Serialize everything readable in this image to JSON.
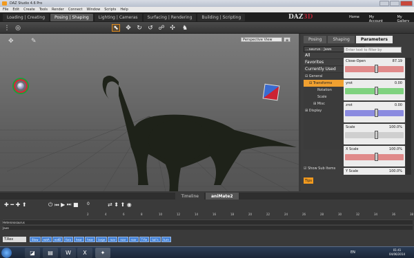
{
  "window": {
    "title": "DAZ Studio 4.6 Pro"
  },
  "menu": [
    "File",
    "Edit",
    "Create",
    "Tools",
    "Render",
    "Connect",
    "Window",
    "Scripts",
    "Help"
  ],
  "header": {
    "tabs": [
      {
        "label": "Loading | Creating",
        "active": false
      },
      {
        "label": "Posing | Shaping",
        "active": true
      },
      {
        "label": "Lighting | Cameras",
        "active": false
      },
      {
        "label": "Surfacing | Rendering",
        "active": false
      },
      {
        "label": "Building | Scripting",
        "active": false
      }
    ],
    "logo_left": "DAZ",
    "logo_right": "3D",
    "links": [
      "Home",
      "My Account",
      "My Gallery"
    ]
  },
  "viewport": {
    "camera": "Perspective View",
    "menu": "≡"
  },
  "right_pane": {
    "tabs": [
      {
        "label": "Posing",
        "active": false
      },
      {
        "label": "Shaping",
        "active": false
      },
      {
        "label": "Parameters",
        "active": true
      }
    ],
    "node_select": "...saurus : Jaws",
    "search_placeholder": "Enter text to filter by",
    "categories": [
      "All",
      "Favorites",
      "Currently Used"
    ],
    "tree": [
      {
        "label": "⊟ General",
        "indent": 0,
        "hl": false
      },
      {
        "label": "⊟ Transforms",
        "indent": 1,
        "hl": true
      },
      {
        "label": "Rotation",
        "indent": 3,
        "hl": false
      },
      {
        "label": "Scale",
        "indent": 3,
        "hl": false
      },
      {
        "label": "⊞ Misc",
        "indent": 2,
        "hl": false
      },
      {
        "label": "⊞ Display",
        "indent": 0,
        "hl": false
      }
    ],
    "show_sub": "Show Sub Items",
    "tips": "Tips",
    "params": [
      {
        "label": "Close-Open",
        "value": "87.19",
        "color": "#e08a8a"
      },
      {
        "label": "yrot",
        "value": "0.00",
        "color": "#7fd27f"
      },
      {
        "label": "zrot",
        "value": "0.00",
        "color": "#8b8be0"
      },
      {
        "label": "Scale",
        "value": "100.0%",
        "color": "#cfcfcf"
      },
      {
        "label": "X Scale",
        "value": "100.0%",
        "color": "#e08a8a"
      },
      {
        "label": "Y Scale",
        "value": "100.0%",
        "color": "#7fd27f"
      }
    ]
  },
  "bottom": {
    "tabs": [
      {
        "label": "Timeline",
        "active": false
      },
      {
        "label": "aniMate2",
        "active": true
      }
    ],
    "frame": "0",
    "ruler": [
      "2",
      "4",
      "6",
      "8",
      "10",
      "12",
      "14",
      "16",
      "18",
      "20",
      "22",
      "24",
      "26",
      "28",
      "30",
      "32",
      "34",
      "36",
      "38",
      "40"
    ],
    "tracks": [
      "Heteronosaurus",
      "Jaws"
    ],
    "figure_select": "T.Rex",
    "clips": [
      "Blow",
      "eatA",
      "eatB",
      "fora",
      "hear",
      "hear",
      "large",
      "roar",
      "roar",
      "roar",
      "T-Re",
      "tail's",
      "turn"
    ]
  },
  "taskbar": {
    "lang": "EN",
    "time": "01:41",
    "date": "04/06/2014"
  }
}
